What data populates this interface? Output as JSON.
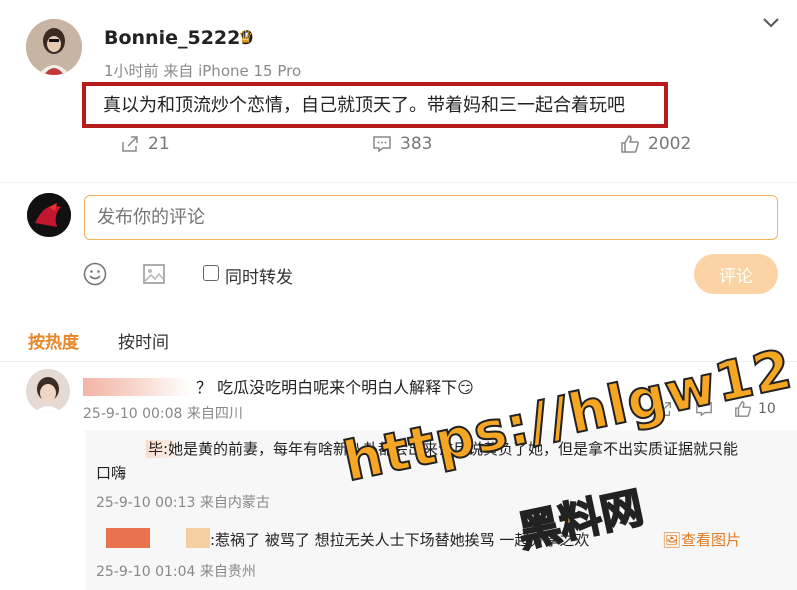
{
  "post": {
    "username": "Bonnie_52229",
    "time": "1小时前",
    "source": "来自 iPhone 15 Pro",
    "content": "真以为和顶流炒个恋情，自己就顶天了。带着妈和三一起合着玩吧",
    "stats": {
      "forward": "21",
      "comment": "383",
      "like": "2002"
    }
  },
  "composer": {
    "placeholder": "发布你的评论",
    "forward_label": "同时转发",
    "submit_label": "评论"
  },
  "sort": {
    "hot": "按热度",
    "time": "按时间"
  },
  "comments": [
    {
      "text": "？ 吃瓜没吃明白呢来个明白人解释下",
      "emoji": "😏",
      "time": "25-9-10 00:08",
      "location": "来自四川",
      "likes": "10"
    }
  ],
  "replies": [
    {
      "line1": "毕:她是黄的前妻，每年有啥新八卦都会出来诈尸说黄负了她，但是拿不出实质证据就只能",
      "line2": "口嗨",
      "time": "25-9-10 00:13",
      "location": "来自内蒙古"
    },
    {
      "text": ":惹祸了 被骂了 想拉无关人士下场替她挨骂 ",
      "mid": "一起",
      "tail": "分享之欢",
      "view_image": "查看图片",
      "time": "25-9-10 01:04",
      "location": "来自贵州"
    }
  ],
  "watermark": {
    "line1": "https://hlgw12.com",
    "line2": "黑料网"
  },
  "colors": {
    "accent": "#e8862a",
    "highlight_border": "#b71c1c",
    "input_border": "#f5b45c",
    "submit_bg": "#fbd3a4"
  }
}
